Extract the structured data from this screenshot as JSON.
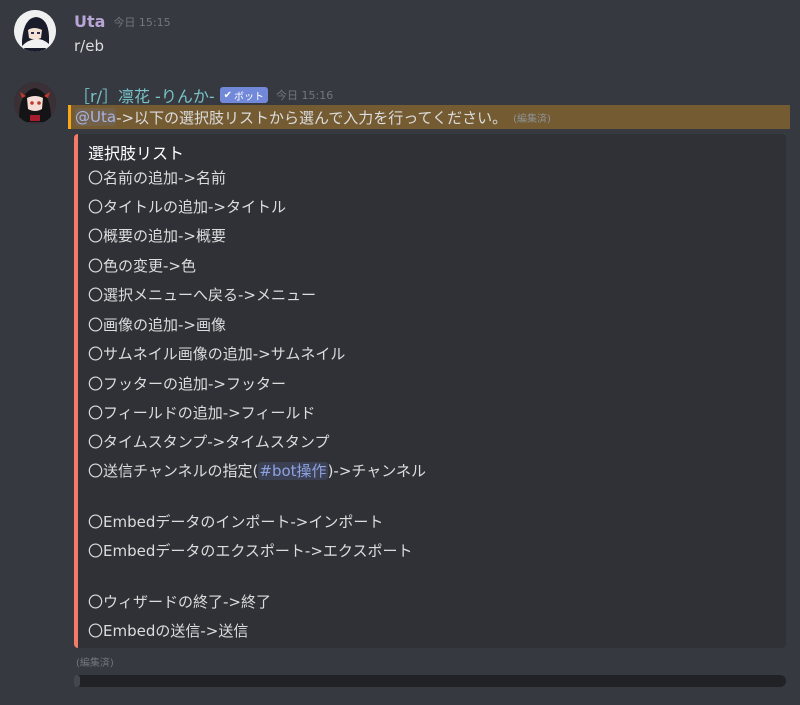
{
  "message1": {
    "username": "Uta",
    "timestamp": "今日 15:15",
    "text": "r/eb"
  },
  "message2": {
    "username": "［r/］凛花 -りんか-",
    "badge": "ボット",
    "timestamp": "今日 15:16",
    "mention": "@Uta",
    "text": "->以下の選択肢リストから選んで入力を行ってください。",
    "edited": "(編集済)"
  },
  "embed": {
    "title": "選択肢リスト",
    "accent_color": "#f47b67",
    "lines": [
      "〇名前の追加->名前",
      "〇タイトルの追加->タイトル",
      "〇概要の追加->概要",
      "〇色の変更->色",
      "〇選択メニューへ戻る->メニュー",
      "〇画像の追加->画像",
      "〇サムネイル画像の追加->サムネイル",
      "〇フッターの追加->フッター",
      "〇フィールドの追加->フィールド",
      "〇タイムスタンプ->タイムスタンプ"
    ],
    "channel_line": {
      "prefix": "〇送信チャンネルの指定(",
      "channel": "#bot操作",
      "suffix": ")->チャンネル"
    },
    "lines2": [
      "〇Embedデータのインポート->インポート",
      "〇Embedデータのエクスポート->エクスポート"
    ],
    "lines3": [
      "〇ウィザードの終了->終了",
      "〇Embedの送信->送信"
    ]
  },
  "embed_edited": "(編集済)"
}
